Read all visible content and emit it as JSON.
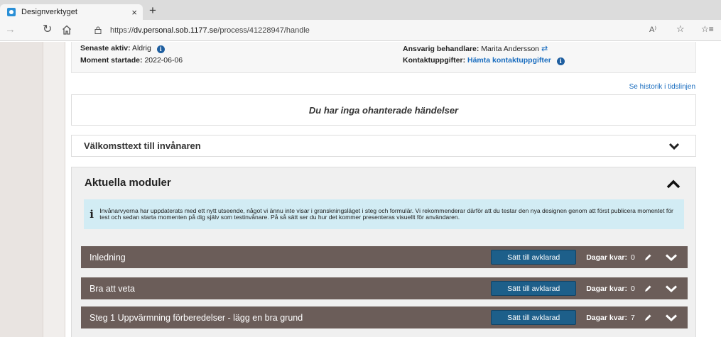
{
  "browser": {
    "tab_title": "Designverktyget",
    "tab_close": "×",
    "new_tab": "+",
    "url_prefix": "https://",
    "url_host": "dv.personal.sob.1177.se",
    "url_path": "/process/41228947/handle",
    "read_aloud": "A⁾",
    "favorites": "☆",
    "collections": "☆≡"
  },
  "info": {
    "last_active_label": "Senaste aktiv:",
    "last_active_value": "Aldrig",
    "moment_started_label": "Moment startade:",
    "moment_started_value": "2022-06-06",
    "responsible_label": "Ansvarig behandlare:",
    "responsible_value": "Marita Andersson",
    "contact_label": "Kontaktuppgifter:",
    "contact_link": "Hämta kontaktuppgifter"
  },
  "history_link": "Se historik i tidslinjen",
  "events_text": "Du har inga ohanterade händelser",
  "welcome_title": "Välkomsttext till invånaren",
  "modules": {
    "title": "Aktuella moduler",
    "notice": "Invånarvyerna har uppdaterats med ett nytt utseende, något vi ännu inte visar i granskningsläget i steg och formulär. Vi rekommenderar därför att du testar den nya designen genom att först publicera momentet för test och sedan starta momenten på dig själv som testinvånare. På så sätt ser du hur det kommer presenteras visuellt för användaren.",
    "items": [
      {
        "title": "Inledning",
        "button": "Sätt till avklarad",
        "days_label": "Dagar kvar:",
        "days": "0"
      },
      {
        "title": "Bra att veta",
        "button": "Sätt till avklarad",
        "days_label": "Dagar kvar:",
        "days": "0"
      },
      {
        "title": "Steg 1 Uppvärmning förberedelser - lägg en bra grund",
        "button": "Sätt till avklarad",
        "days_label": "Dagar kvar:",
        "days": "7"
      }
    ]
  },
  "colors": {
    "module_bar": "#6b5d59",
    "button_blue": "#1d5f8a",
    "link_blue": "#1a6dbf",
    "notice_bg": "#d2ecf4",
    "info_icon": "#1f5fa0"
  }
}
